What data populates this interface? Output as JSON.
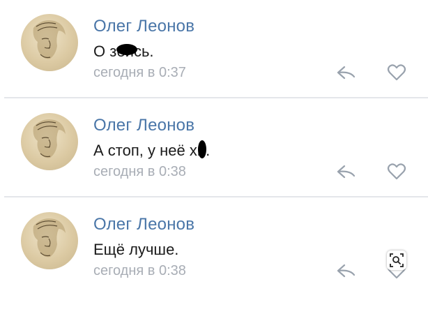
{
  "comments": [
    {
      "author": "Олег Леонов",
      "text_before": "О з",
      "text_after": "бись.",
      "time": "сегодня в 0:37"
    },
    {
      "author": "Олег Леонов",
      "text_before": "А стоп, у неё х",
      "text_after": "й.",
      "time": "сегодня в 0:38"
    },
    {
      "author": "Олег Леонов",
      "text_before": "Ещё лучше.",
      "text_after": "",
      "time": "сегодня в 0:38"
    }
  ],
  "icons": {
    "reply": "reply-arrow-icon",
    "like": "heart-icon",
    "visual_search": "visual-search-lens-icon"
  },
  "colors": {
    "author_link": "#4a76a8",
    "timestamp": "#a8adb5",
    "divider": "#e4e6ea",
    "action_icon": "#99a2ad"
  }
}
